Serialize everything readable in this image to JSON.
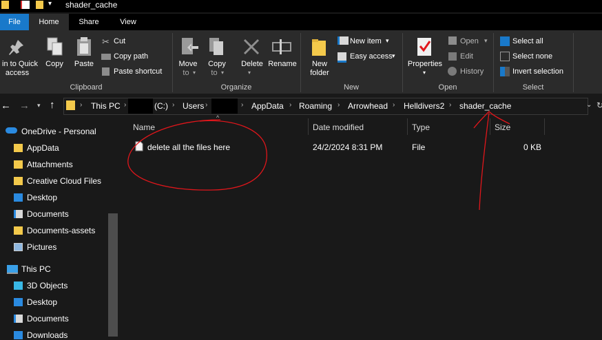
{
  "window": {
    "title": "shader_cache"
  },
  "tabs": {
    "file": "File",
    "home": "Home",
    "share": "Share",
    "view": "View"
  },
  "ribbon": {
    "clipboard": {
      "pin_label_1": "in to Quick",
      "pin_label_2": "access",
      "copy": "Copy",
      "paste": "Paste",
      "cut": "Cut",
      "copy_path": "Copy path",
      "paste_shortcut": "Paste shortcut",
      "group": "Clipboard"
    },
    "organize": {
      "move_to_1": "Move",
      "move_to_2": "to",
      "copy_to_1": "Copy",
      "copy_to_2": "to",
      "delete": "Delete",
      "rename": "Rename",
      "group": "Organize"
    },
    "new": {
      "new_folder_1": "New",
      "new_folder_2": "folder",
      "new_item": "New item",
      "easy_access": "Easy access",
      "group": "New"
    },
    "open": {
      "properties": "Properties",
      "open": "Open",
      "edit": "Edit",
      "history": "History",
      "group": "Open"
    },
    "select": {
      "select_all": "Select all",
      "select_none": "Select none",
      "invert": "Invert selection",
      "group": "Select"
    }
  },
  "address": {
    "crumbs": [
      "This PC",
      "(C:)",
      "Users",
      "AppData",
      "Roaming",
      "Arrowhead",
      "Helldivers2",
      "shader_cache"
    ]
  },
  "nav": {
    "onedrive": "OneDrive - Personal",
    "items": [
      "AppData",
      "Attachments",
      "Creative Cloud Files",
      "Desktop",
      "Documents",
      "Documents-assets",
      "Pictures"
    ],
    "thispc": "This PC",
    "pc_items": [
      "3D Objects",
      "Desktop",
      "Documents",
      "Downloads"
    ]
  },
  "columns": {
    "name": "Name",
    "date": "Date modified",
    "type": "Type",
    "size": "Size"
  },
  "files": [
    {
      "name": "delete all the files here",
      "date": "24/2/2024 8:31 PM",
      "type": "File",
      "size": "0 KB"
    }
  ],
  "colors": {
    "accent": "#1979ca",
    "annotation": "#e0161b",
    "folder": "#f3c94b"
  }
}
